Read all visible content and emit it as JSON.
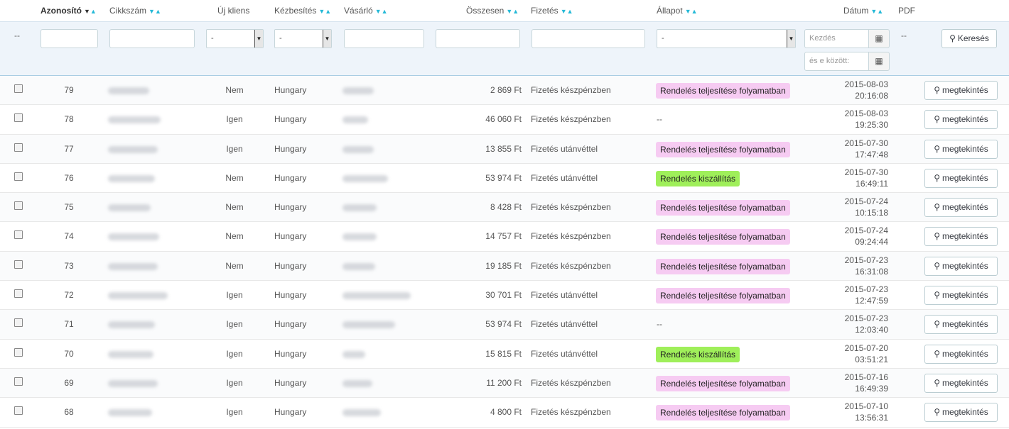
{
  "header": {
    "columns": [
      {
        "label": "Azonosító",
        "active": true
      },
      {
        "label": "Cikkszám"
      },
      {
        "label": "Új kliens"
      },
      {
        "label": "Kézbesítés"
      },
      {
        "label": "Vásárló"
      },
      {
        "label": "Összesen"
      },
      {
        "label": "Fizetés"
      },
      {
        "label": "Állapot"
      },
      {
        "label": "Dátum"
      },
      {
        "label": "PDF"
      }
    ],
    "sort_down": "▼",
    "sort_up": "▲"
  },
  "filters": {
    "dash": "--",
    "select_default": "-",
    "date_from_placeholder": "Kezdés",
    "date_to_placeholder": "és e között:",
    "search_label": "Keresés",
    "calendar_glyph": "▦",
    "search_glyph": "⚲"
  },
  "colors": {
    "pink_badge": "#f6cbf2",
    "green_badge": "#9fef5a",
    "accent": "#25b9d7"
  },
  "view_label": "megtekintés",
  "rows": [
    {
      "id": "79",
      "new": "Nem",
      "delivery": "Hungary",
      "total": "2 869 Ft",
      "payment": "Fizetés készpénzben",
      "status": "Rendelés teljesítése folyamatban",
      "status_type": "pink",
      "date": "2015-08-03",
      "time": "20:16:08"
    },
    {
      "id": "78",
      "new": "Igen",
      "delivery": "Hungary",
      "total": "46 060 Ft",
      "payment": "Fizetés készpénzben",
      "status": "--",
      "status_type": "none",
      "date": "2015-08-03",
      "time": "19:25:30"
    },
    {
      "id": "77",
      "new": "Igen",
      "delivery": "Hungary",
      "total": "13 855 Ft",
      "payment": "Fizetés utánvéttel",
      "status": "Rendelés teljesítése folyamatban",
      "status_type": "pink",
      "date": "2015-07-30",
      "time": "17:47:48"
    },
    {
      "id": "76",
      "new": "Nem",
      "delivery": "Hungary",
      "total": "53 974 Ft",
      "payment": "Fizetés utánvéttel",
      "status": "Rendelés kiszállítás",
      "status_type": "green",
      "date": "2015-07-30",
      "time": "16:49:11"
    },
    {
      "id": "75",
      "new": "Nem",
      "delivery": "Hungary",
      "total": "8 428 Ft",
      "payment": "Fizetés készpénzben",
      "status": "Rendelés teljesítése folyamatban",
      "status_type": "pink",
      "date": "2015-07-24",
      "time": "10:15:18"
    },
    {
      "id": "74",
      "new": "Nem",
      "delivery": "Hungary",
      "total": "14 757 Ft",
      "payment": "Fizetés készpénzben",
      "status": "Rendelés teljesítése folyamatban",
      "status_type": "pink",
      "date": "2015-07-24",
      "time": "09:24:44"
    },
    {
      "id": "73",
      "new": "Nem",
      "delivery": "Hungary",
      "total": "19 185 Ft",
      "payment": "Fizetés készpénzben",
      "status": "Rendelés teljesítése folyamatban",
      "status_type": "pink",
      "date": "2015-07-23",
      "time": "16:31:08"
    },
    {
      "id": "72",
      "new": "Igen",
      "delivery": "Hungary",
      "total": "30 701 Ft",
      "payment": "Fizetés utánvéttel",
      "status": "Rendelés teljesítése folyamatban",
      "status_type": "pink",
      "date": "2015-07-23",
      "time": "12:47:59"
    },
    {
      "id": "71",
      "new": "Igen",
      "delivery": "Hungary",
      "total": "53 974 Ft",
      "payment": "Fizetés utánvéttel",
      "status": "--",
      "status_type": "none",
      "date": "2015-07-23",
      "time": "12:03:40"
    },
    {
      "id": "70",
      "new": "Igen",
      "delivery": "Hungary",
      "total": "15 815 Ft",
      "payment": "Fizetés utánvéttel",
      "status": "Rendelés kiszállítás",
      "status_type": "green",
      "date": "2015-07-20",
      "time": "03:51:21"
    },
    {
      "id": "69",
      "new": "Igen",
      "delivery": "Hungary",
      "total": "11 200 Ft",
      "payment": "Fizetés készpénzben",
      "status": "Rendelés teljesítése folyamatban",
      "status_type": "pink",
      "date": "2015-07-16",
      "time": "16:49:39"
    },
    {
      "id": "68",
      "new": "Igen",
      "delivery": "Hungary",
      "total": "4 800 Ft",
      "payment": "Fizetés készpénzben",
      "status": "Rendelés teljesítése folyamatban",
      "status_type": "pink",
      "date": "2015-07-10",
      "time": "13:56:31"
    }
  ]
}
